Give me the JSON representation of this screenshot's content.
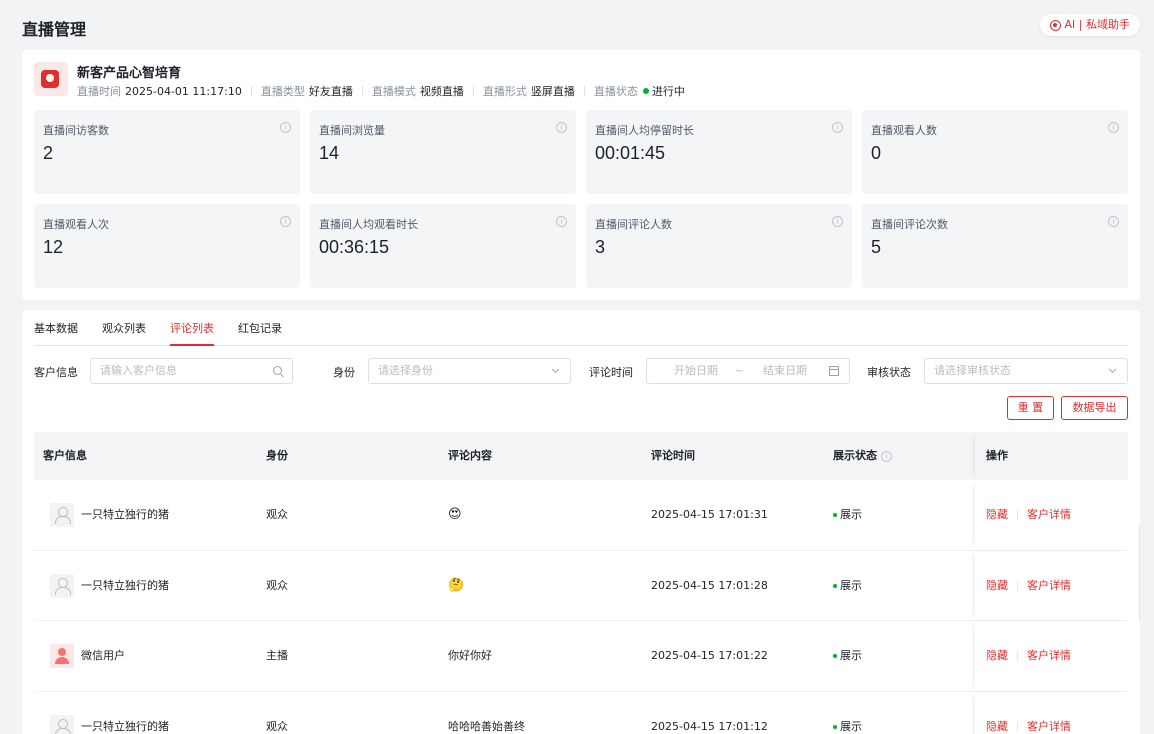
{
  "header": {
    "title": "直播管理",
    "ai_button": "AI | 私域助手"
  },
  "live": {
    "name": "新客产品心智培育",
    "meta": [
      {
        "label": "直播时间",
        "value": "2025-04-01 11:17:10"
      },
      {
        "label": "直播类型",
        "value": "好友直播"
      },
      {
        "label": "直播模式",
        "value": "视频直播"
      },
      {
        "label": "直播形式",
        "value": "竖屏直播"
      },
      {
        "label": "直播状态",
        "value": "进行中"
      }
    ],
    "status_color": "#00b42a"
  },
  "stats": [
    {
      "label": "直播间访客数",
      "value": "2"
    },
    {
      "label": "直播间浏览量",
      "value": "14"
    },
    {
      "label": "直播间人均停留时长",
      "value": "00:01:45"
    },
    {
      "label": "直播观看人数",
      "value": "0"
    },
    {
      "label": "直播观看人次",
      "value": "12"
    },
    {
      "label": "直播间人均观看时长",
      "value": "00:36:15"
    },
    {
      "label": "直播间评论人数",
      "value": "3"
    },
    {
      "label": "直播间评论次数",
      "value": "5"
    }
  ],
  "tabs": [
    {
      "label": "基本数据",
      "active": false
    },
    {
      "label": "观众列表",
      "active": false
    },
    {
      "label": "评论列表",
      "active": true
    },
    {
      "label": "红包记录",
      "active": false
    }
  ],
  "filters": {
    "customer_label": "客户信息",
    "customer_placeholder": "请输入客户信息",
    "identity_label": "身份",
    "identity_placeholder": "请选择身份",
    "time_label": "评论时间",
    "start_placeholder": "开始日期",
    "range_sep": "~",
    "end_placeholder": "结束日期",
    "audit_label": "审核状态",
    "audit_placeholder": "请选择审核状态"
  },
  "buttons": {
    "reset": "重 置",
    "export": "数据导出"
  },
  "table": {
    "columns": [
      "客户信息",
      "身份",
      "评论内容",
      "评论时间",
      "展示状态",
      "操作"
    ],
    "rows": [
      {
        "user": "一只特立独行的猪",
        "avatar": "default",
        "identity": "观众",
        "content": "😍",
        "time": "2025-04-15 17:01:31",
        "status": "展示",
        "action_hide": "隐藏",
        "action_detail": "客户详情"
      },
      {
        "user": "一只特立独行的猪",
        "avatar": "default",
        "identity": "观众",
        "content": "🤔",
        "time": "2025-04-15 17:01:28",
        "status": "展示",
        "action_hide": "隐藏",
        "action_detail": "客户详情"
      },
      {
        "user": "微信用户",
        "avatar": "pink",
        "identity": "主播",
        "content": "你好你好",
        "time": "2025-04-15 17:01:22",
        "status": "展示",
        "action_hide": "隐藏",
        "action_detail": "客户详情"
      },
      {
        "user": "一只特立独行的猪",
        "avatar": "default",
        "identity": "观众",
        "content": "哈哈哈善始善终",
        "time": "2025-04-15 17:01:12",
        "status": "展示",
        "action_hide": "隐藏",
        "action_detail": "客户详情"
      }
    ]
  },
  "accent_color": "#e02e2e"
}
